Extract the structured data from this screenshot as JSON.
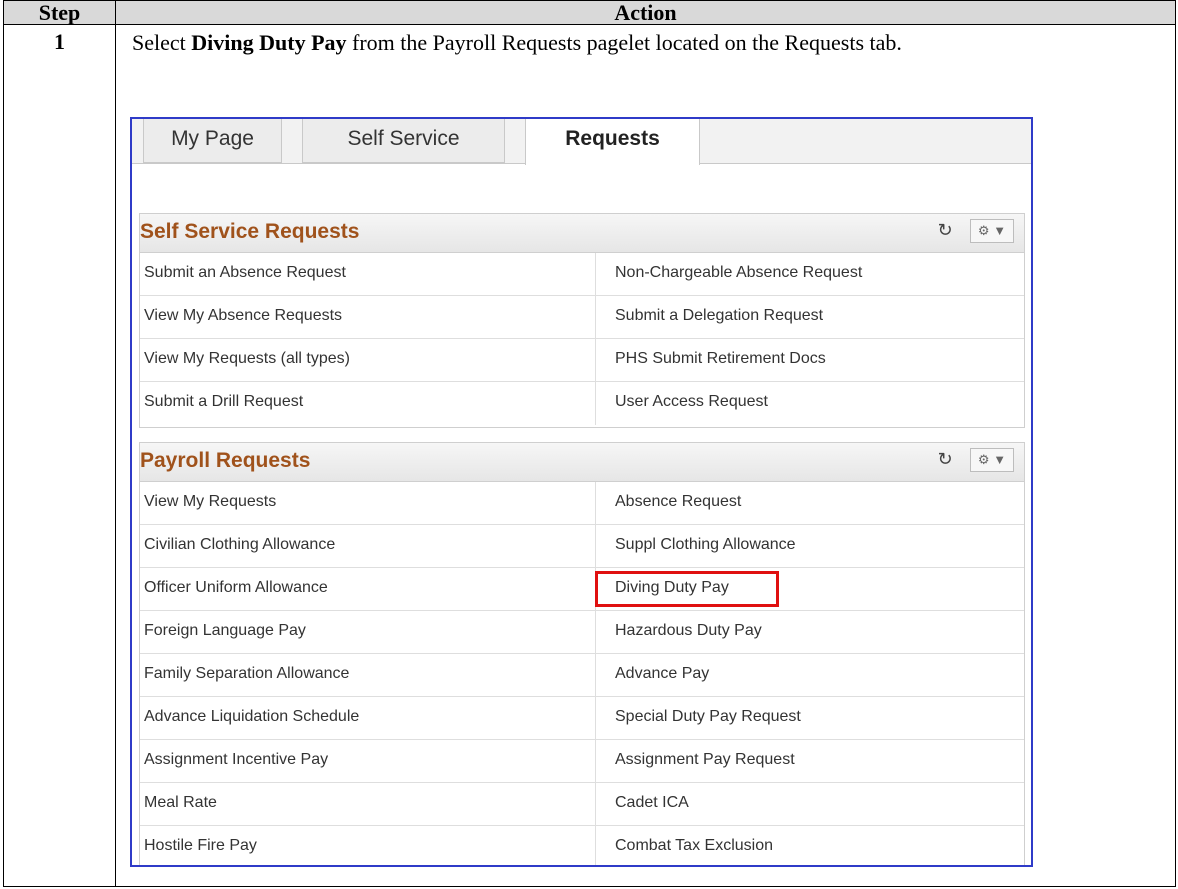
{
  "table": {
    "header_step": "Step",
    "header_action": "Action",
    "step_number": "1",
    "instruction_pre": "Select ",
    "instruction_bold": "Diving Duty Pay",
    "instruction_post": " from the Payroll Requests pagelet located on the Requests tab."
  },
  "screenshot": {
    "tabs": [
      "My Page",
      "Self Service",
      "Requests"
    ],
    "active_tab": "Requests",
    "self_service": {
      "title": "Self Service Requests",
      "rows": [
        [
          "Submit an Absence Request",
          "Non-Chargeable Absence Request"
        ],
        [
          "View My Absence Requests",
          "Submit a Delegation Request"
        ],
        [
          "View My Requests (all types)",
          "PHS Submit Retirement Docs"
        ],
        [
          "Submit a Drill Request",
          "User Access Request"
        ]
      ]
    },
    "payroll": {
      "title": "Payroll Requests",
      "rows": [
        [
          "View My Requests",
          "Absence Request"
        ],
        [
          "Civilian Clothing Allowance",
          "Suppl Clothing Allowance"
        ],
        [
          "Officer Uniform Allowance",
          "Diving Duty Pay"
        ],
        [
          "Foreign Language Pay",
          "Hazardous Duty Pay"
        ],
        [
          "Family Separation Allowance",
          "Advance Pay"
        ],
        [
          "Advance Liquidation Schedule",
          "Special Duty Pay Request"
        ],
        [
          "Assignment Incentive Pay",
          "Assignment Pay Request"
        ],
        [
          "Meal Rate",
          "Cadet ICA"
        ],
        [
          "Hostile Fire Pay",
          "Combat Tax Exclusion"
        ]
      ],
      "highlighted_item": "Diving Duty Pay"
    },
    "colors": {
      "pagelet_title": "#a0521b",
      "highlight": "#e01010",
      "screenshot_border": "#2f3bc8"
    },
    "icons": [
      "refresh-icon",
      "gear-icon",
      "chevron-down-icon"
    ]
  }
}
